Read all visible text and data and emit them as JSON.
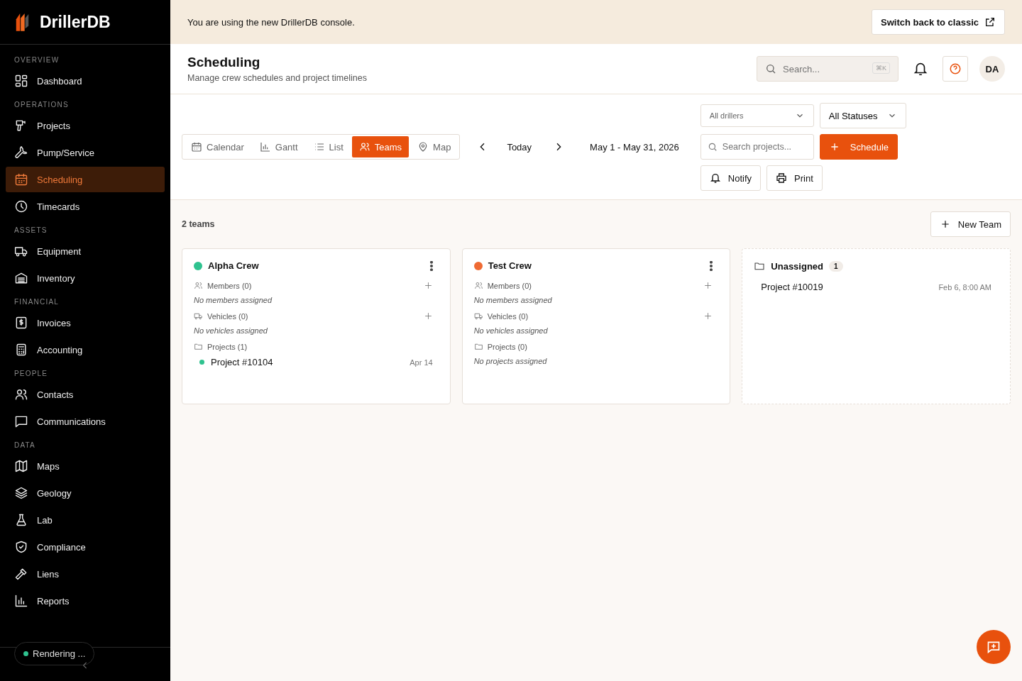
{
  "brand": {
    "name": "DrillerDB"
  },
  "sidebar": {
    "sections": [
      {
        "label": "OVERVIEW",
        "items": [
          {
            "label": "Dashboard",
            "selected": false
          }
        ]
      },
      {
        "label": "OPERATIONS",
        "items": [
          {
            "label": "Projects",
            "selected": false
          },
          {
            "label": "Pump/Service",
            "selected": false
          },
          {
            "label": "Scheduling",
            "selected": true
          },
          {
            "label": "Timecards",
            "selected": false
          }
        ]
      },
      {
        "label": "ASSETS",
        "items": [
          {
            "label": "Equipment",
            "selected": false
          },
          {
            "label": "Inventory",
            "selected": false
          }
        ]
      },
      {
        "label": "FINANCIAL",
        "items": [
          {
            "label": "Invoices",
            "selected": false
          },
          {
            "label": "Accounting",
            "selected": false
          }
        ]
      },
      {
        "label": "PEOPLE",
        "items": [
          {
            "label": "Contacts",
            "selected": false
          },
          {
            "label": "Communications",
            "selected": false
          }
        ]
      },
      {
        "label": "DATA",
        "items": [
          {
            "label": "Maps",
            "selected": false
          },
          {
            "label": "Geology",
            "selected": false
          },
          {
            "label": "Lab",
            "selected": false
          },
          {
            "label": "Compliance",
            "selected": false
          },
          {
            "label": "Liens",
            "selected": false
          },
          {
            "label": "Reports",
            "selected": false
          }
        ]
      }
    ],
    "status": {
      "label": "Rendering ...",
      "color": "#2fc28f"
    }
  },
  "banner": {
    "text": "You are using the new DrillerDB console.",
    "button": "Switch back to classic"
  },
  "header": {
    "title": "Scheduling",
    "subtitle": "Manage crew schedules and project timelines",
    "search_placeholder": "Search...",
    "shortcut": "⌘K",
    "avatar": "DA"
  },
  "views": [
    {
      "label": "Calendar",
      "selected": false
    },
    {
      "label": "Gantt",
      "selected": false
    },
    {
      "label": "List",
      "selected": false
    },
    {
      "label": "Teams",
      "selected": true
    },
    {
      "label": "Map",
      "selected": false
    }
  ],
  "nav": {
    "today": "Today",
    "range": "May 1 - May 31, 2026"
  },
  "filters": {
    "drillers": "All drillers",
    "statuses": "All Statuses",
    "search_placeholder": "Search projects...",
    "schedule": "Schedule",
    "notify": "Notify",
    "print": "Print"
  },
  "teams_count": "2 teams",
  "new_team": "New Team",
  "teams": [
    {
      "name": "Alpha Crew",
      "color": "#2fc28f",
      "sections": [
        {
          "kind": "members",
          "label": "Members (0)",
          "add": true,
          "empty": "No members assigned"
        },
        {
          "kind": "vehicles",
          "label": "Vehicles (0)",
          "add": true,
          "empty": "No vehicles assigned"
        },
        {
          "kind": "projects",
          "label": "Projects (1)",
          "add": false,
          "items": [
            {
              "name": "Project #10104",
              "date": "Apr 14",
              "color": "#2fc28f"
            }
          ]
        }
      ]
    },
    {
      "name": "Test Crew",
      "color": "#ef6a33",
      "sections": [
        {
          "kind": "members",
          "label": "Members (0)",
          "add": true,
          "empty": "No members assigned"
        },
        {
          "kind": "vehicles",
          "label": "Vehicles (0)",
          "add": true,
          "empty": "No vehicles assigned"
        },
        {
          "kind": "projects",
          "label": "Projects (0)",
          "add": false,
          "empty": "No projects assigned"
        }
      ]
    }
  ],
  "unassigned": {
    "label": "Unassigned",
    "count": "1",
    "items": [
      {
        "name": "Project #10019",
        "date": "Feb 6, 8:00 AM"
      }
    ]
  }
}
